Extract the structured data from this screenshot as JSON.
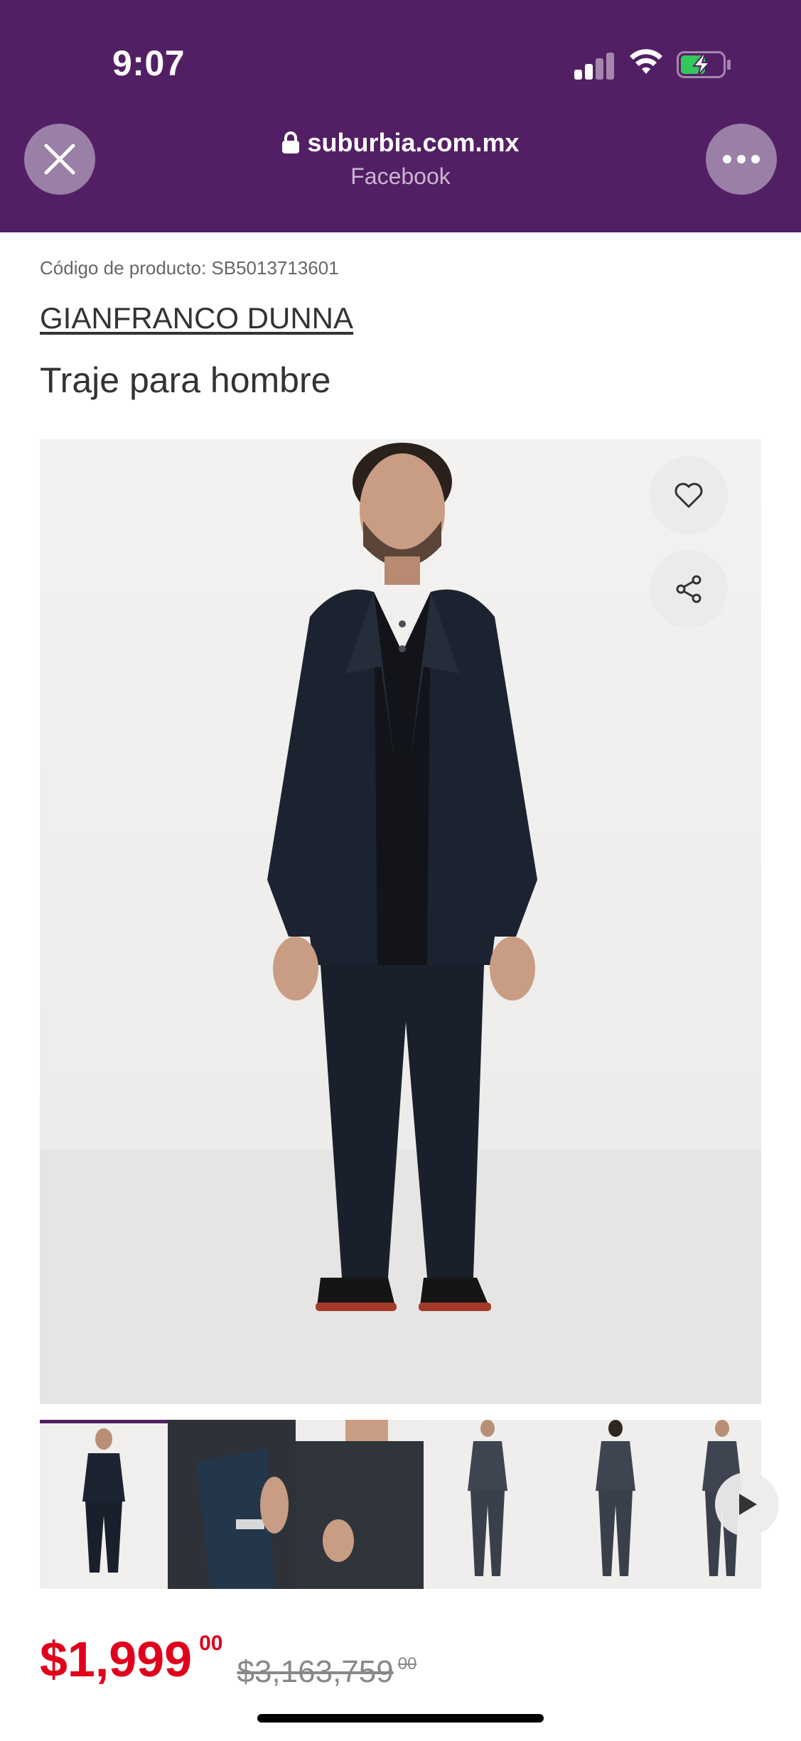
{
  "status_bar": {
    "time": "9:07"
  },
  "browser": {
    "url": "suburbia.com.mx",
    "source": "Facebook",
    "close_icon": "close-icon",
    "more_icon": "more-dots-icon"
  },
  "product": {
    "code": "Código de producto: SB5013713601",
    "brand": "GIANFRANCO DUNNA",
    "title": "Traje para hombre",
    "price": "$1,999",
    "price_cents": "00",
    "old_price": "$3,163,759",
    "old_price_cents": "00",
    "gallery_count": 6,
    "active_thumbnail": 1
  },
  "colors": {
    "brand_purple": "#531f64",
    "price_red": "#e0001b",
    "suit_navy": "#1c2330"
  },
  "icons": {
    "favorite": "heart-icon",
    "share": "share-icon",
    "next": "play-next-icon",
    "lock": "lock-icon"
  }
}
